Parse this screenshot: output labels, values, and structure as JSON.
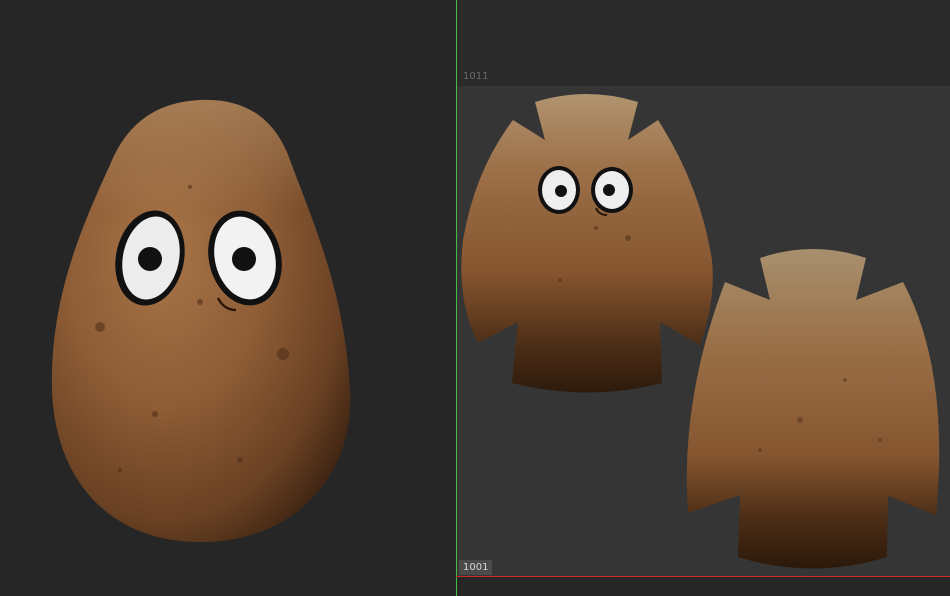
{
  "uv_editor": {
    "tile_upper_label": "1011",
    "tile_main_label": "1001"
  },
  "colors": {
    "background": "#262626",
    "uv_tile": "#353535",
    "potato_skin": "#8a5a34",
    "v_axis": "#3fbf3f",
    "u_axis": "#d12a2a"
  },
  "icons": [
    "potato-model",
    "uv-shell-front",
    "uv-shell-back"
  ]
}
